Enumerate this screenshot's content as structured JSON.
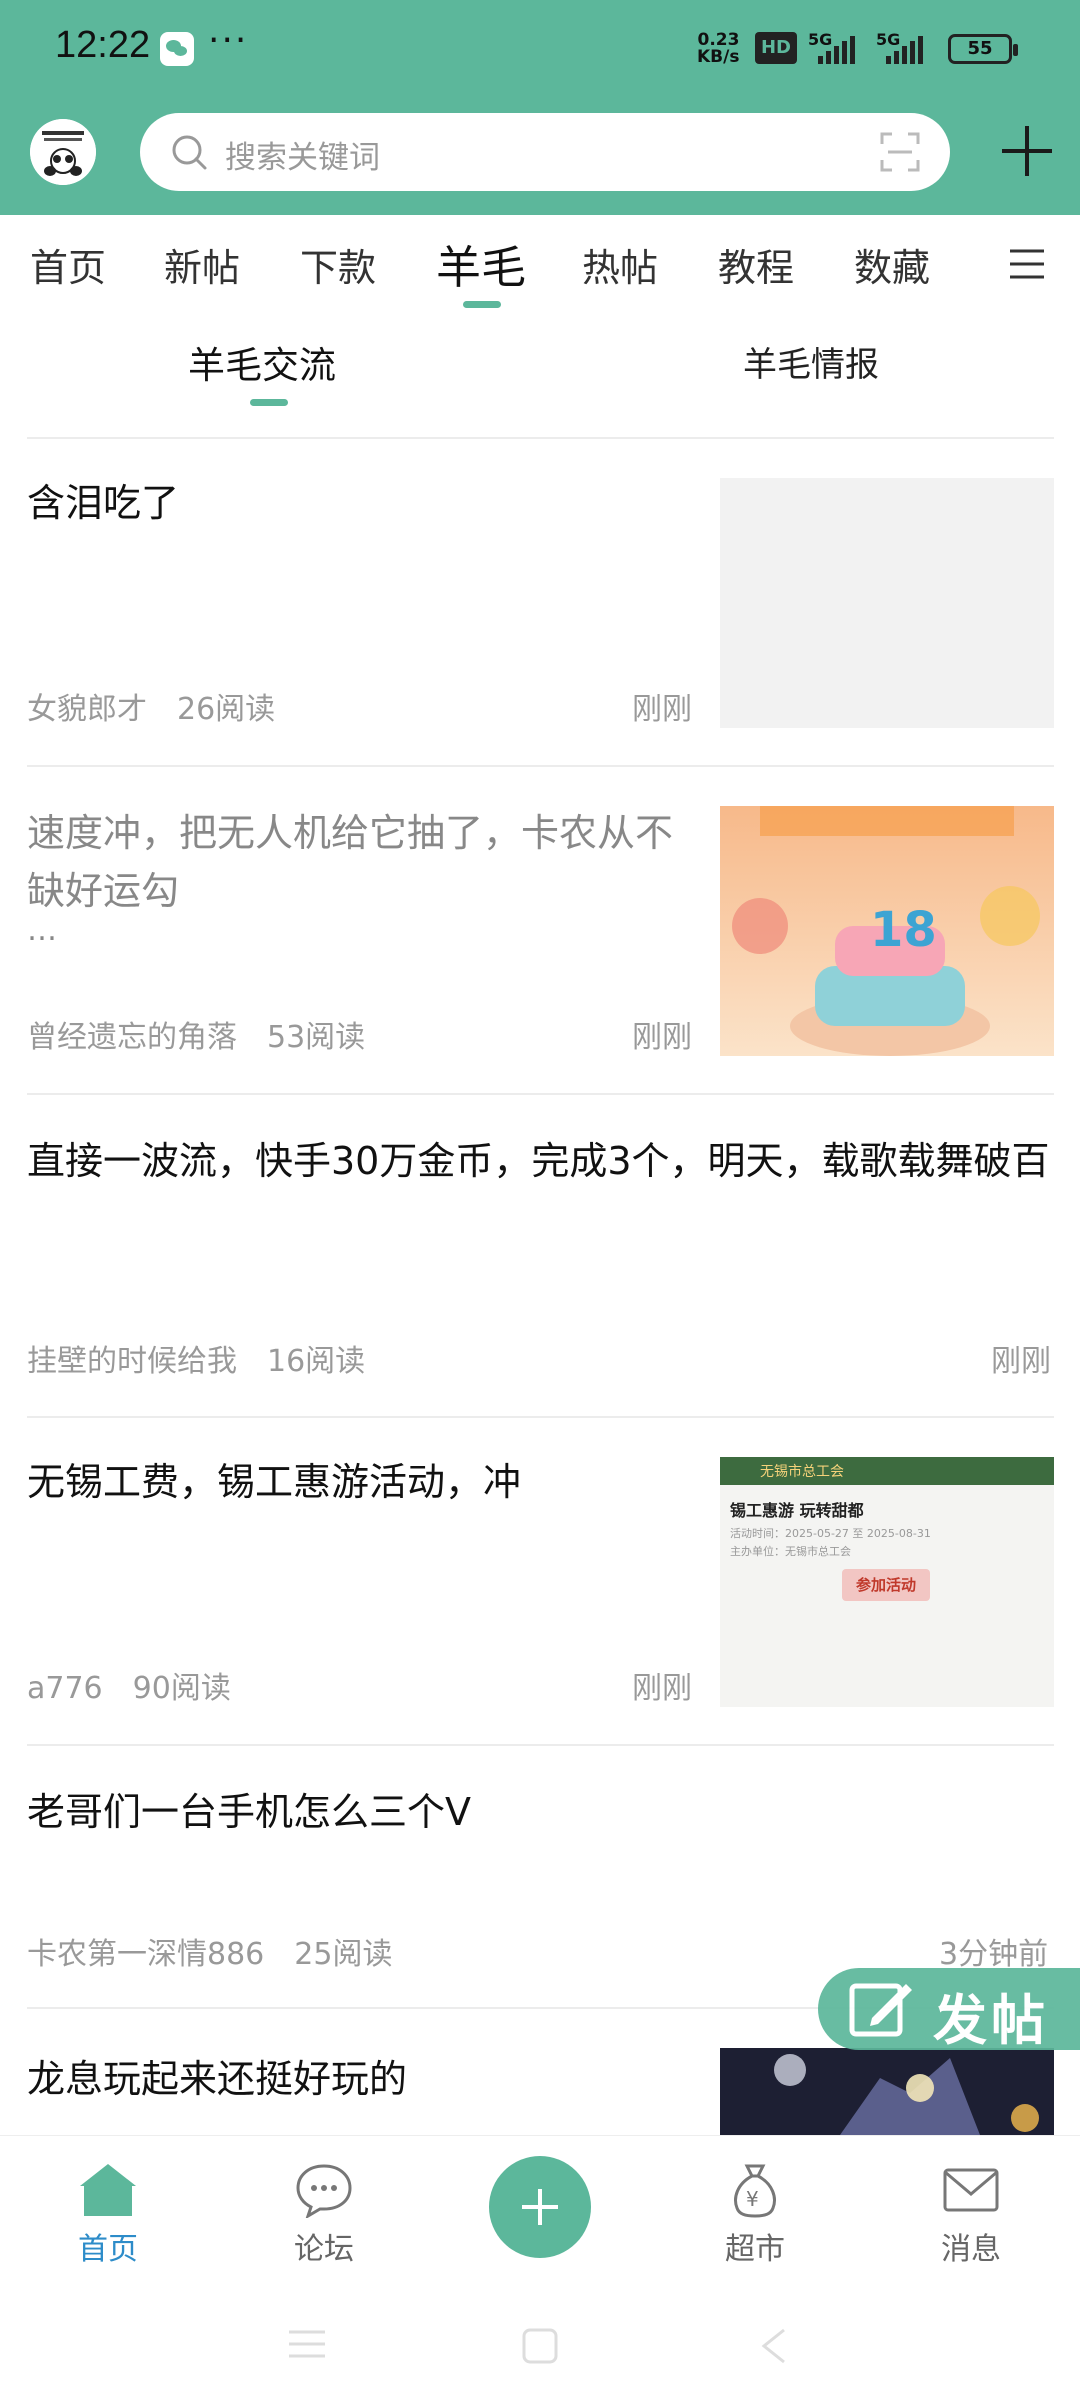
{
  "status_bar": {
    "time": "12:22",
    "more": "···",
    "net_speed_value": "0.23",
    "net_speed_unit": "KB/s",
    "hd": "HD",
    "signal1": "5G",
    "signal2": "5G",
    "battery": "55"
  },
  "header": {
    "search_placeholder": "搜索关键词",
    "accent_color": "#5cb79b"
  },
  "tabs": [
    {
      "label": "首页"
    },
    {
      "label": "新帖"
    },
    {
      "label": "下款"
    },
    {
      "label": "羊毛"
    },
    {
      "label": "热帖"
    },
    {
      "label": "教程"
    },
    {
      "label": "数藏"
    }
  ],
  "active_tab": "羊毛",
  "subtabs": [
    {
      "label": "羊毛交流"
    },
    {
      "label": "羊毛情报"
    }
  ],
  "posts": [
    {
      "title": "含泪吃了",
      "author": "女貌郎才",
      "reads": "26阅读",
      "time": "刚刚",
      "thumb": "blank"
    },
    {
      "title": "速度冲，把无人机给它抽了，卡农从不缺好运勾",
      "ellipsis": "…",
      "author": "曾经遗忘的角落",
      "reads": "53阅读",
      "time": "刚刚",
      "thumb": "birthday-cake"
    },
    {
      "title": "直接一波流，快手30万金币，完成3个，明天，载歌载舞破百",
      "author": "挂壁的时候给我",
      "reads": "16阅读",
      "time": "刚刚"
    },
    {
      "title": "无锡工费，锡工惠游活动，冲",
      "author": "a776",
      "reads": "90阅读",
      "time": "刚刚",
      "thumb": "event-card",
      "thumb_text": {
        "head": "无锡市总工会",
        "title": "锡工惠游 玩转甜都",
        "line1": "活动时间：2025-05-27 至 2025-08-31",
        "line2": "主办单位：无锡市总工会",
        "button": "参加活动"
      }
    },
    {
      "title": "老哥们一台手机怎么三个V",
      "author": "卡农第一深情886",
      "reads": "25阅读",
      "time": "3分钟前"
    },
    {
      "title": "龙息玩起来还挺好玩的",
      "thumb": "game-art"
    }
  ],
  "fab": {
    "label": "发帖"
  },
  "bottom_nav": [
    {
      "label": "首页",
      "icon": "home-icon",
      "active": true
    },
    {
      "label": "论坛",
      "icon": "chat-bubble-icon"
    },
    {
      "label": "",
      "icon": "plus-icon"
    },
    {
      "label": "超市",
      "icon": "money-bag-icon"
    },
    {
      "label": "消息",
      "icon": "mail-icon"
    }
  ]
}
